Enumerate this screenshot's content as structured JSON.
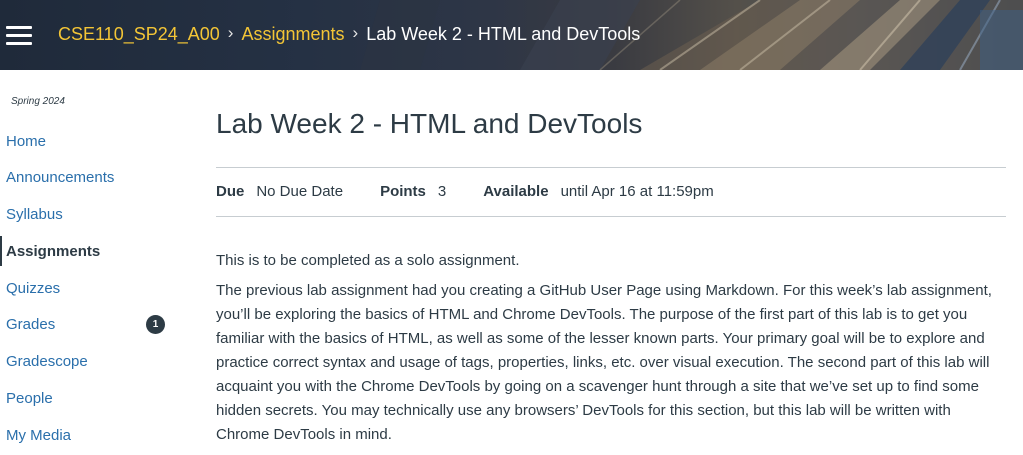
{
  "header": {
    "breadcrumbs": [
      {
        "label": "CSE110_SP24_A00"
      },
      {
        "label": "Assignments"
      },
      {
        "label": "Lab Week 2 - HTML and DevTools"
      }
    ],
    "separator": "›",
    "menu_icon": "hamburger-menu-icon"
  },
  "sidebar": {
    "term": "Spring 2024",
    "items": [
      {
        "label": "Home"
      },
      {
        "label": "Announcements"
      },
      {
        "label": "Syllabus"
      },
      {
        "label": "Assignments",
        "active": true
      },
      {
        "label": "Quizzes"
      },
      {
        "label": "Grades",
        "badge": "1"
      },
      {
        "label": "Gradescope"
      },
      {
        "label": "People"
      },
      {
        "label": "My Media"
      }
    ]
  },
  "assignment": {
    "title": "Lab Week 2 - HTML and DevTools",
    "due_label": "Due",
    "due_value": "No Due Date",
    "points_label": "Points",
    "points_value": "3",
    "available_label": "Available",
    "available_value": "until Apr 16 at 11:59pm",
    "paragraphs": [
      "This is to be completed as a solo assignment.",
      "The previous lab assignment had you creating a GitHub User Page using Markdown. For this week’s lab assignment, you’ll be exploring the basics of HTML and Chrome DevTools. The purpose of the first part of this lab is to get you familiar with the basics of HTML, as well as some of the lesser known parts. Your primary goal will be to explore and practice correct syntax and usage of tags, properties, links, etc. over visual execution. The second part of this lab will acquaint you with the Chrome DevTools by going on a scavenger hunt through a site that we’ve set up to find some hidden secrets. You may technically use any browsers’ DevTools for this section, but this lab will be written with Chrome DevTools in mind."
    ]
  },
  "colors": {
    "breadcrumb_link": "#f3c536",
    "nav_link": "#2a6fab",
    "text": "#2d3b45",
    "badge_bg": "#2d3b45",
    "rule": "#c7cdd1"
  }
}
